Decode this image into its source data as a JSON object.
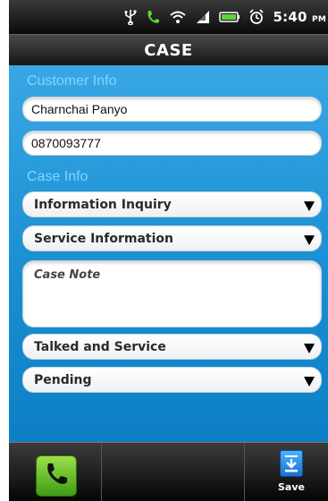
{
  "status_bar": {
    "time": "5:40",
    "time_suffix": "PM",
    "icons": [
      "usb-icon",
      "phone-call-icon",
      "wifi-icon",
      "signal-icon",
      "battery-icon",
      "alarm-icon"
    ]
  },
  "header": {
    "title": "CASE"
  },
  "customer_info": {
    "label": "Customer  Info",
    "name_value": "Charnchai Panyo",
    "phone_value": "0870093777"
  },
  "case_info": {
    "label": "Case Info",
    "case_type": "Information Inquiry",
    "case_category": "Service Information",
    "case_note_placeholder": "Case Note",
    "action_taken": "Talked and Service",
    "status": "Pending"
  },
  "bottom_bar": {
    "call_icon": "phone-handset-icon",
    "save_label": "Save",
    "save_icon": "download-save-icon"
  },
  "colors": {
    "background_blue": "#1f8fcf",
    "section_label": "#7fd6ff",
    "call_green": "#5cbf1e",
    "bar_dark": "#151515"
  }
}
